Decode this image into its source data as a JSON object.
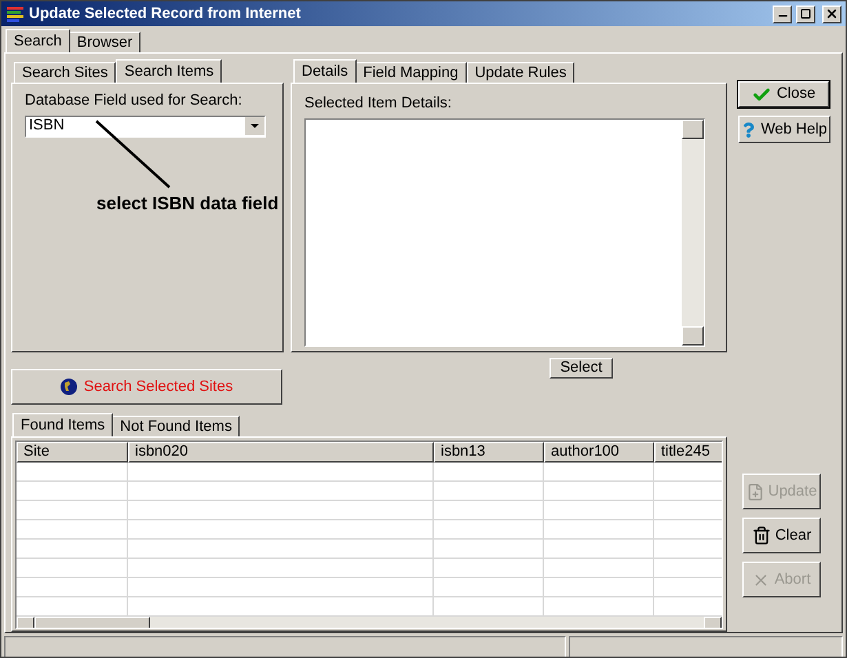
{
  "window": {
    "title": "Update Selected Record from Internet"
  },
  "main_tabs": [
    {
      "label": "Search",
      "selected": true
    },
    {
      "label": "Browser",
      "selected": false
    }
  ],
  "search_tabs": [
    {
      "label": "Search Sites",
      "selected": false
    },
    {
      "label": "Search Items",
      "selected": true
    }
  ],
  "search_field": {
    "label": "Database Field used for Search:",
    "value": "ISBN"
  },
  "annotation": "select ISBN data field",
  "detail_tabs": [
    {
      "label": "Details",
      "selected": true
    },
    {
      "label": "Field Mapping",
      "selected": false
    },
    {
      "label": "Update Rules",
      "selected": false
    }
  ],
  "details_label": "Selected Item Details:",
  "close_button": "Close",
  "help_button": "Web Help",
  "select_button": "Select",
  "search_button": "Search Selected Sites",
  "result_tabs": [
    {
      "label": "Found Items",
      "selected": true
    },
    {
      "label": "Not Found Items",
      "selected": false
    }
  ],
  "table": {
    "columns": [
      "Site",
      "isbn020",
      "isbn13",
      "author100",
      "title245"
    ]
  },
  "side_buttons": [
    {
      "kind": "update",
      "label": "Update",
      "disabled": true
    },
    {
      "kind": "clear",
      "label": "Clear",
      "disabled": false
    },
    {
      "kind": "abort",
      "label": "Abort",
      "disabled": true
    }
  ]
}
